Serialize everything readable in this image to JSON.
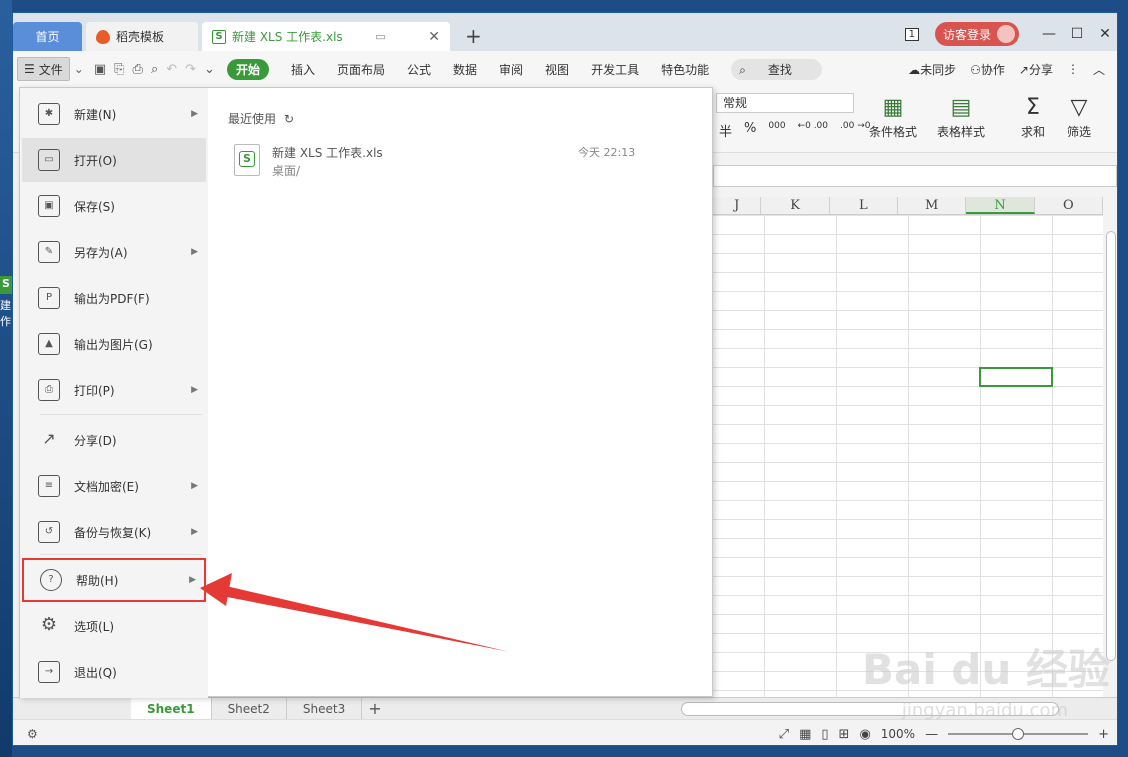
{
  "desktop": {
    "icon_text": [
      "建",
      "作"
    ]
  },
  "window": {
    "tabs": {
      "home": "首页",
      "templates": "稻壳模板",
      "document": "新建 XLS 工作表.xls"
    },
    "badge": "1",
    "login": "访客登录",
    "controls": {
      "min": "—",
      "max": "☐",
      "close": "✕"
    }
  },
  "toolbar": {
    "file_label": "文件",
    "menu_tabs": [
      "开始",
      "插入",
      "页面布局",
      "公式",
      "数据",
      "审阅",
      "视图",
      "开发工具",
      "特色功能"
    ],
    "search": "查找",
    "unsync": "未同步",
    "collab": "协作",
    "share": "分享"
  },
  "ribbon": {
    "number_format": "常规",
    "number_buttons": [
      "半",
      "%",
      "000",
      "←0 .00",
      ".00 →0"
    ],
    "cond_format": "条件格式",
    "table_style": "表格样式",
    "sum": "求和",
    "filter": "筛选"
  },
  "grid": {
    "columns": [
      "J",
      "K",
      "L",
      "M",
      "N",
      "O"
    ],
    "selected_column": "N"
  },
  "sheets": [
    "Sheet1",
    "Sheet2",
    "Sheet3"
  ],
  "status": {
    "zoom": "100%"
  },
  "file_menu": {
    "items": [
      {
        "label": "新建(N)",
        "icon": "new-icon"
      },
      {
        "label": "打开(O)",
        "icon": "folder-icon"
      },
      {
        "label": "保存(S)",
        "icon": "save-icon"
      },
      {
        "label": "另存为(A)",
        "icon": "save-as-icon"
      },
      {
        "label": "输出为PDF(F)",
        "icon": "pdf-icon"
      },
      {
        "label": "输出为图片(G)",
        "icon": "image-icon"
      },
      {
        "label": "打印(P)",
        "icon": "print-icon"
      },
      {
        "label": "分享(D)",
        "icon": "share-icon"
      },
      {
        "label": "文档加密(E)",
        "icon": "lock-icon"
      },
      {
        "label": "备份与恢复(K)",
        "icon": "backup-icon"
      },
      {
        "label": "帮助(H)",
        "icon": "help-icon"
      },
      {
        "label": "选项(L)",
        "icon": "gear-icon"
      },
      {
        "label": "退出(Q)",
        "icon": "exit-icon"
      }
    ],
    "recent_header": "最近使用",
    "recent": [
      {
        "name": "新建 XLS 工作表.xls",
        "path": "桌面/",
        "time": "今天 22:13"
      }
    ]
  },
  "watermark": {
    "logo": "Bai du 经验",
    "url": "jingyan.baidu.com"
  },
  "colors": {
    "accent": "#3a9a3a",
    "highlight": "#e53935",
    "home_tab": "#5b8ed9"
  }
}
